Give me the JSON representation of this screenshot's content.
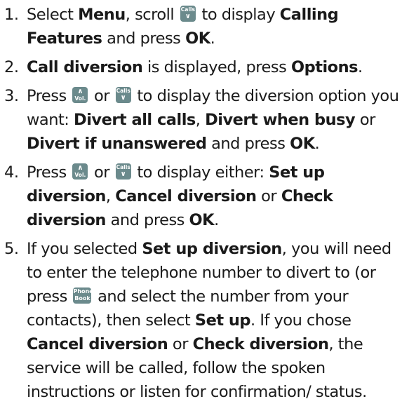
{
  "keys": {
    "calls": "Calls",
    "vol": "Vol.",
    "phone_line1": "Phone",
    "phone_line2": "Book"
  },
  "steps": [
    {
      "number": "1.",
      "parts": [
        "Select ",
        "Menu",
        ", scroll ",
        " to display ",
        "Calling Features",
        " and press ",
        "OK",
        "."
      ]
    },
    {
      "number": "2.",
      "parts": [
        "Call diversion",
        " is displayed, press ",
        "Options",
        "."
      ]
    },
    {
      "number": "3.",
      "parts": [
        "Press ",
        " or ",
        " to display the diversion option you want: ",
        "Divert all calls",
        ", ",
        "Divert when busy",
        " or ",
        "Divert if unanswered",
        " and press ",
        "OK",
        "."
      ]
    },
    {
      "number": "4.",
      "parts": [
        "Press ",
        " or ",
        " to display either: ",
        "Set up diversion",
        ", ",
        "Cancel diversion",
        " or ",
        "Check diversion",
        " and press ",
        "OK",
        "."
      ]
    },
    {
      "number": "5.",
      "parts": [
        "If you selected ",
        "Set up diversion",
        ", you will need to enter the telephone number to divert to (or press ",
        " and select the number from your contacts), then select ",
        "Set up",
        ". If you chose ",
        "Cancel diversion",
        " or ",
        "Check diversion",
        ", the service will be called, follow the spoken instructions or listen for confirmation/ status."
      ]
    }
  ]
}
